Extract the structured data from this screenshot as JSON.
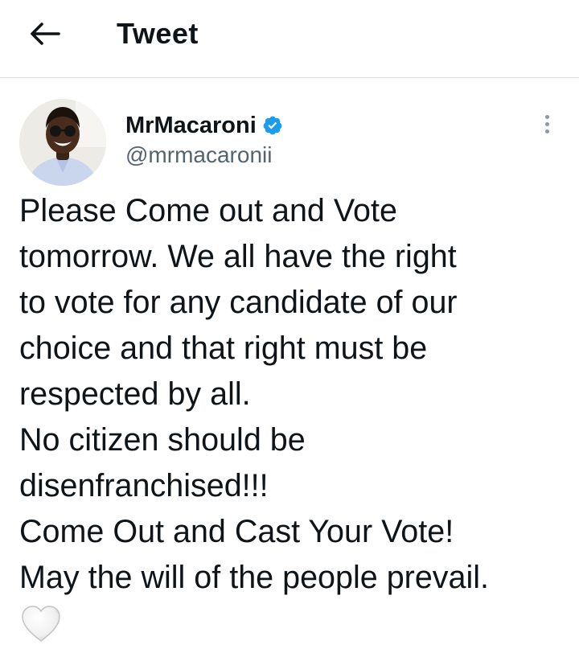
{
  "header": {
    "back_icon": "arrow-left-icon",
    "title": "Tweet"
  },
  "tweet": {
    "author": {
      "display_name": "MrMacaroni",
      "handle": "@mrmacaronii",
      "verified": true,
      "verified_icon": "verified-badge-icon",
      "avatar_icon": "avatar"
    },
    "more_icon": "more-vertical-icon",
    "text_lines": [
      "Please Come out and Vote",
      "tomorrow. We all have the right",
      "to vote for any candidate of our",
      "choice and that right must be",
      "respected by all.",
      "No citizen should be",
      "disenfranchised!!!",
      "Come Out and Cast Your Vote!",
      "May the will of the people prevail."
    ],
    "emoji_icon": "white-heart-icon"
  },
  "colors": {
    "text_primary": "#0f1419",
    "text_secondary": "#536471",
    "verified_blue": "#1d9bf0",
    "divider": "#d9dde0"
  }
}
